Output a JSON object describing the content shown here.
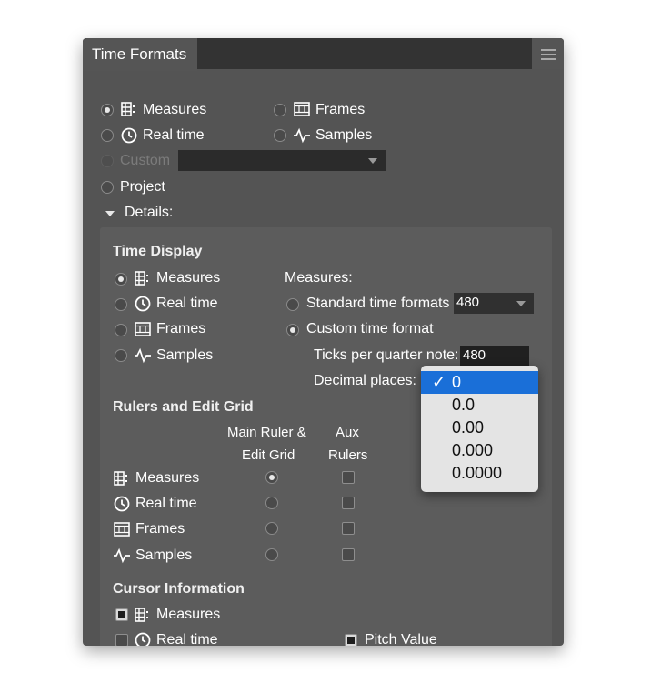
{
  "panel": {
    "title": "Time Formats",
    "menu_icon": "hamburger-menu-icon"
  },
  "main_format": {
    "options": [
      {
        "label": "Measures",
        "icon": "measures-icon",
        "selected": true
      },
      {
        "label": "Frames",
        "icon": "frames-icon",
        "selected": false
      },
      {
        "label": "Real time",
        "icon": "clock-icon",
        "selected": false
      },
      {
        "label": "Samples",
        "icon": "samples-wave-icon",
        "selected": false
      },
      {
        "label": "Custom",
        "icon": "",
        "selected": false,
        "disabled": true
      },
      {
        "label": "Project",
        "icon": "",
        "selected": false
      }
    ],
    "custom_select_value": ""
  },
  "details": {
    "label": "Details:",
    "expanded": true
  },
  "time_display": {
    "heading": "Time Display",
    "options": [
      {
        "label": "Measures",
        "selected": true
      },
      {
        "label": "Real time",
        "selected": false
      },
      {
        "label": "Frames",
        "selected": false
      },
      {
        "label": "Samples",
        "selected": false
      }
    ],
    "measures_heading": "Measures:",
    "standard_label": "Standard time formats",
    "standard_value": "480",
    "custom_label": "Custom time format",
    "custom_selected": true,
    "ticks_label": "Ticks per quarter note:",
    "ticks_value": "480",
    "decimal_label": "Decimal places:"
  },
  "decimal_popup": {
    "items": [
      "0",
      "0.0",
      "0.00",
      "0.000",
      "0.0000"
    ],
    "selected_index": 0,
    "check_mark": "✓"
  },
  "rulers": {
    "heading": "Rulers and Edit Grid",
    "col1_line1": "Main Ruler &",
    "col1_line2": "Edit Grid",
    "col2_line1": "Aux",
    "col2_line2": "Rulers",
    "rows": [
      {
        "label": "Measures",
        "main_selected": true,
        "aux_checked": false
      },
      {
        "label": "Real time",
        "main_selected": false,
        "aux_checked": false
      },
      {
        "label": "Frames",
        "main_selected": false,
        "aux_checked": false
      },
      {
        "label": "Samples",
        "main_selected": false,
        "aux_checked": false
      }
    ]
  },
  "cursor_info": {
    "heading": "Cursor Information",
    "measures_label": "Measures",
    "measures_checked": true,
    "realtime_label": "Real time",
    "realtime_checked": false,
    "pitch_label": "Pitch Value",
    "pitch_checked": true
  },
  "colors": {
    "panel_bg": "#545454",
    "title_bar": "#333333",
    "highlight": "#1a6fd8"
  }
}
